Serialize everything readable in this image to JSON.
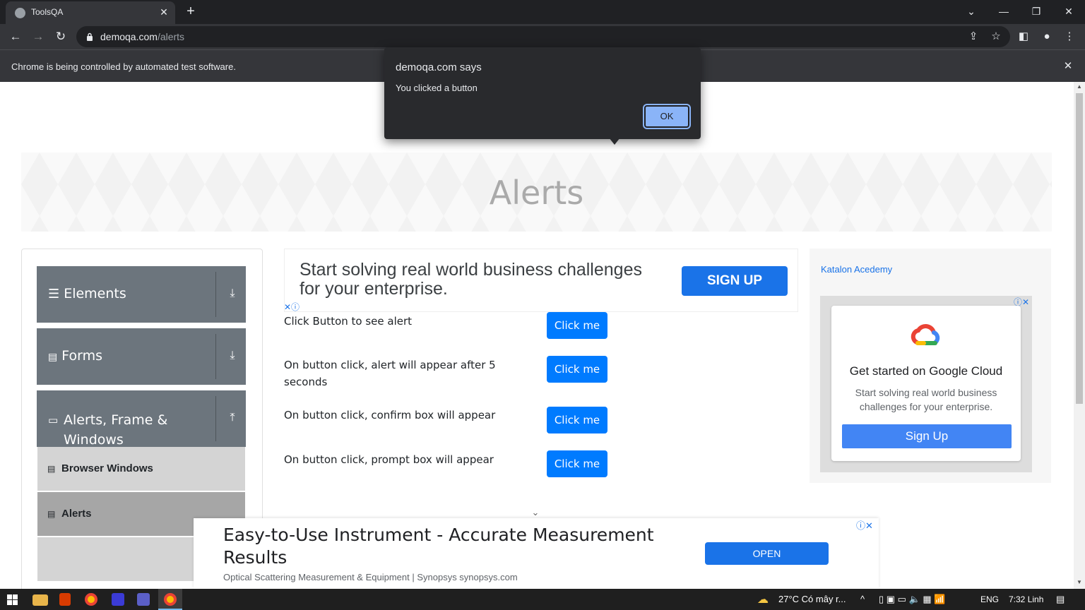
{
  "browser": {
    "tab_title": "ToolsQA",
    "tab_close": "✕",
    "new_tab": "+",
    "url_host": "demoqa.com",
    "url_path": "/alerts",
    "infobar_text": "Chrome is being controlled by automated test software.",
    "infobar_close": "✕"
  },
  "page": {
    "banner_title": "Alerts",
    "sidebar": {
      "groups": [
        {
          "label": "Elements",
          "arrow": "⤓"
        },
        {
          "label": "Forms",
          "arrow": "⤓"
        },
        {
          "label": "Alerts, Frame & Windows",
          "arrow": "⤒"
        }
      ],
      "items": [
        {
          "label": "Browser Windows"
        },
        {
          "label": "Alerts"
        }
      ]
    },
    "top_ad": {
      "text": "Start solving real world business challenges for your enterprise.",
      "button": "SIGN UP",
      "adchoice": "✕ⓘ"
    },
    "rows": [
      {
        "label": "Click Button to see alert",
        "button": "Click me"
      },
      {
        "label": "On button click, alert will appear after 5 seconds",
        "button": "Click me"
      },
      {
        "label": "On button click, confirm box will appear",
        "button": "Click me"
      },
      {
        "label": "On button click, prompt box will appear",
        "button": "Click me"
      }
    ],
    "right_ad": {
      "link_text": "Katalon Acedemy",
      "title": "Get started on Google Cloud",
      "subtitle": "Start solving real world business challenges for your enterprise.",
      "button": "Sign Up",
      "adchoice": "ⓘ✕"
    },
    "bottom_ad": {
      "title": "Easy-to-Use Instrument - Accurate Measurement Results",
      "subtitle": "Optical Scattering Measurement & Equipment | Synopsys synopsys.com",
      "button": "OPEN",
      "adchoice": "ⓘ✕"
    }
  },
  "alert": {
    "title": "demoqa.com says",
    "message": "You clicked a button",
    "ok": "OK"
  },
  "taskbar": {
    "weather": "27°C  Có mây r...",
    "lang": "ENG",
    "time": "7:32 Linh"
  },
  "colors": {
    "accent": "#007bff",
    "sidebar_group": "#6c757d",
    "dialog_bg": "#292a2d"
  }
}
